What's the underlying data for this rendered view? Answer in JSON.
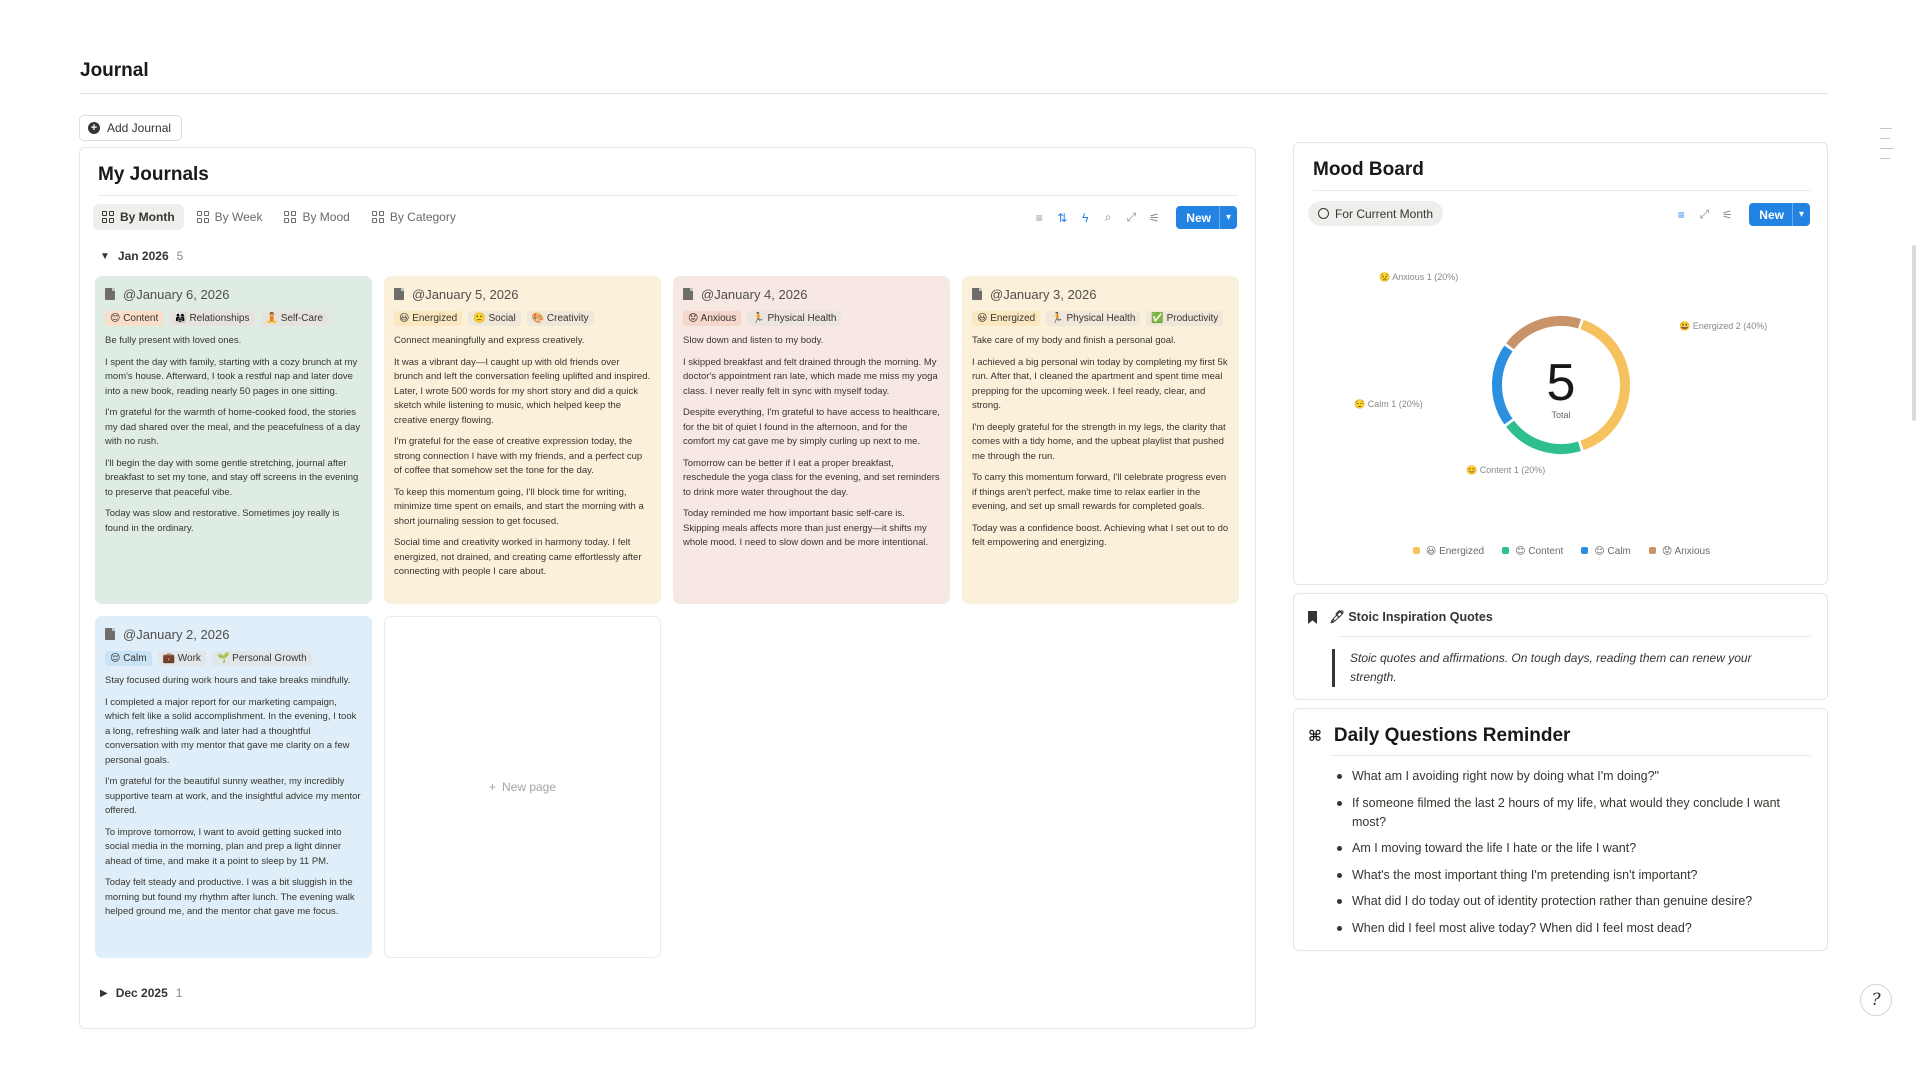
{
  "page": {
    "title": "Journal",
    "add_journal_label": "Add Journal"
  },
  "journals": {
    "heading": "My Journals",
    "tabs": [
      {
        "label": "By Month",
        "active": true
      },
      {
        "label": "By Week",
        "active": false
      },
      {
        "label": "By Mood",
        "active": false
      },
      {
        "label": "By Category",
        "active": false
      }
    ],
    "toolbar_icons": [
      "filter-icon",
      "sort-icon",
      "lightning-icon",
      "search-icon",
      "expand-icon",
      "settings-icon"
    ],
    "new_label": "New",
    "groups": [
      {
        "label": "Jan 2026",
        "count": "5",
        "expanded": true
      },
      {
        "label": "Dec 2025",
        "count": "1",
        "expanded": false
      }
    ],
    "new_page_label": "New page",
    "cards": [
      {
        "date": "@January 6, 2026",
        "bg": "#dfece4",
        "tags": [
          {
            "label": "😊 Content",
            "color": "#fadec9"
          },
          {
            "label": "👨‍👩‍👧 Relationships",
            "color": "#e6e3de"
          },
          {
            "label": "🧘 Self-Care",
            "color": "#e6e3de"
          }
        ],
        "paragraphs": [
          "Be fully present with loved ones.",
          "I spent the day with family, starting with a cozy brunch at my mom's house. Afterward, I took a restful nap and later dove into a new book, reading nearly 50 pages in one sitting.",
          "I'm grateful for the warmth of home-cooked food, the stories my dad shared over the meal, and the peacefulness of a day with no rush.",
          "I'll begin the day with some gentle stretching, journal after breakfast to set my tone, and stay off screens in the evening to preserve that peaceful vibe.",
          "Today was slow and restorative. Sometimes joy really is found in the ordinary."
        ]
      },
      {
        "date": "@January 5, 2026",
        "bg": "#fbf0d9",
        "tags": [
          {
            "label": "😃 Energized",
            "color": "#fbe8c0"
          },
          {
            "label": "🙂 Social",
            "color": "#efe7d9"
          },
          {
            "label": "🎨 Creativity",
            "color": "#efe7d9"
          }
        ],
        "paragraphs": [
          "Connect meaningfully and express creatively.",
          "It was a vibrant day—I caught up with old friends over brunch and left the conversation feeling uplifted and inspired. Later, I wrote 500 words for my short story and did a quick sketch while listening to music, which helped keep the creative energy flowing.",
          "I'm grateful for the ease of creative expression today, the strong connection I have with my friends, and a perfect cup of coffee that somehow set the tone for the day.",
          "To keep this momentum going, I'll block time for writing, minimize time spent on emails, and start the morning with a short journaling session to get focused.",
          "Social time and creativity worked in harmony today. I felt energized, not drained, and creating came effortlessly after connecting with people I care about."
        ]
      },
      {
        "date": "@January 4, 2026",
        "bg": "#f8e8e4",
        "tags": [
          {
            "label": "😟 Anxious",
            "color": "#f5d6cc"
          },
          {
            "label": "🏃 Physical Health",
            "color": "#ece4df"
          }
        ],
        "paragraphs": [
          "Slow down and listen to my body.",
          "I skipped breakfast and felt drained through the morning. My doctor's appointment ran late, which made me miss my yoga class. I never really felt in sync with myself today.",
          "Despite everything, I'm grateful to have access to healthcare, for the bit of quiet I found in the afternoon, and for the comfort my cat gave me by simply curling up next to me.",
          "Tomorrow can be better if I eat a proper breakfast, reschedule the yoga class for the evening, and set reminders to drink more water throughout the day.",
          "Today reminded me how important basic self-care is. Skipping meals affects more than just energy—it shifts my whole mood. I need to slow down and be more intentional."
        ]
      },
      {
        "date": "@January 3, 2026",
        "bg": "#fbf0d9",
        "tags": [
          {
            "label": "😃 Energized",
            "color": "#fbe8c0"
          },
          {
            "label": "🏃 Physical Health",
            "color": "#efe7d9"
          },
          {
            "label": "✅ Productivity",
            "color": "#efe7d9"
          }
        ],
        "paragraphs": [
          "Take care of my body and finish a personal goal.",
          "I achieved a big personal win today by completing my first 5k run. After that, I cleaned the apartment and spent time meal prepping for the upcoming week. I feel ready, clear, and strong.",
          "I'm deeply grateful for the strength in my legs, the clarity that comes with a tidy home, and the upbeat playlist that pushed me through the run.",
          "To carry this momentum forward, I'll celebrate progress even if things aren't perfect, make time to relax earlier in the evening, and set up small rewards for completed goals.",
          "Today was a confidence boost. Achieving what I set out to do felt empowering and energizing."
        ]
      },
      {
        "date": "@January 2, 2026",
        "bg": "#dfeef9",
        "tags": [
          {
            "label": "😌 Calm",
            "color": "#c9e3f6"
          },
          {
            "label": "💼 Work",
            "color": "#e0e6ea"
          },
          {
            "label": "🌱 Personal Growth",
            "color": "#e0e6ea"
          }
        ],
        "paragraphs": [
          "Stay focused during work hours and take breaks mindfully.",
          "I completed a major report for our marketing campaign, which felt like a solid accomplishment. In the evening, I took a long, refreshing walk and later had a thoughtful conversation with my mentor that gave me clarity on a few personal goals.",
          "I'm grateful for the beautiful sunny weather, my incredibly supportive team at work, and the insightful advice my mentor offered.",
          "To improve tomorrow, I want to avoid getting sucked into social media in the morning, plan and prep a light dinner ahead of time, and make it a point to sleep by 11 PM.",
          "Today felt steady and productive. I was a bit sluggish in the morning but found my rhythm after lunch. The evening walk helped ground me, and the mentor chat gave me focus."
        ]
      }
    ]
  },
  "mood_board": {
    "title": "Mood Board",
    "filter_label": "For Current Month",
    "new_label": "New",
    "total": "5",
    "total_label": "Total",
    "colors": {
      "Energized": "#f5c25e",
      "Content": "#2fbf8f",
      "Calm": "#2d8fe0",
      "Anxious": "#c9936a"
    },
    "slice_labels": {
      "anxious": "😟 Anxious 1 (20%)",
      "energized": "😃 Energized 2 (40%)",
      "calm": "😌 Calm 1 (20%)",
      "content": "😊 Content 1 (20%)"
    },
    "legend": [
      "😃 Energized",
      "😊 Content",
      "😌 Calm",
      "😟 Anxious"
    ]
  },
  "chart_data": {
    "type": "pie",
    "categories": [
      "Energized",
      "Content",
      "Calm",
      "Anxious"
    ],
    "values": [
      2,
      1,
      1,
      1
    ],
    "percentages": [
      40,
      20,
      20,
      20
    ],
    "total": 5,
    "legend_position": "bottom"
  },
  "stoic": {
    "title": "🖋 Stoic Inspiration Quotes",
    "quote": "Stoic quotes and affirmations. On tough days, reading them can renew your strength."
  },
  "questions": {
    "title": "Daily Questions Reminder",
    "items": [
      "What am I avoiding right now by doing what I'm doing?\"",
      "If someone filmed the last 2 hours of my life, what would they conclude I want most?",
      "Am I moving toward the life I hate or the life I want?",
      "What's the most important thing I'm pretending isn't important?",
      "What did I do today out of identity protection rather than genuine desire?",
      "When did I feel most alive today? When did I feel most dead?"
    ]
  },
  "help_glyph": "?"
}
